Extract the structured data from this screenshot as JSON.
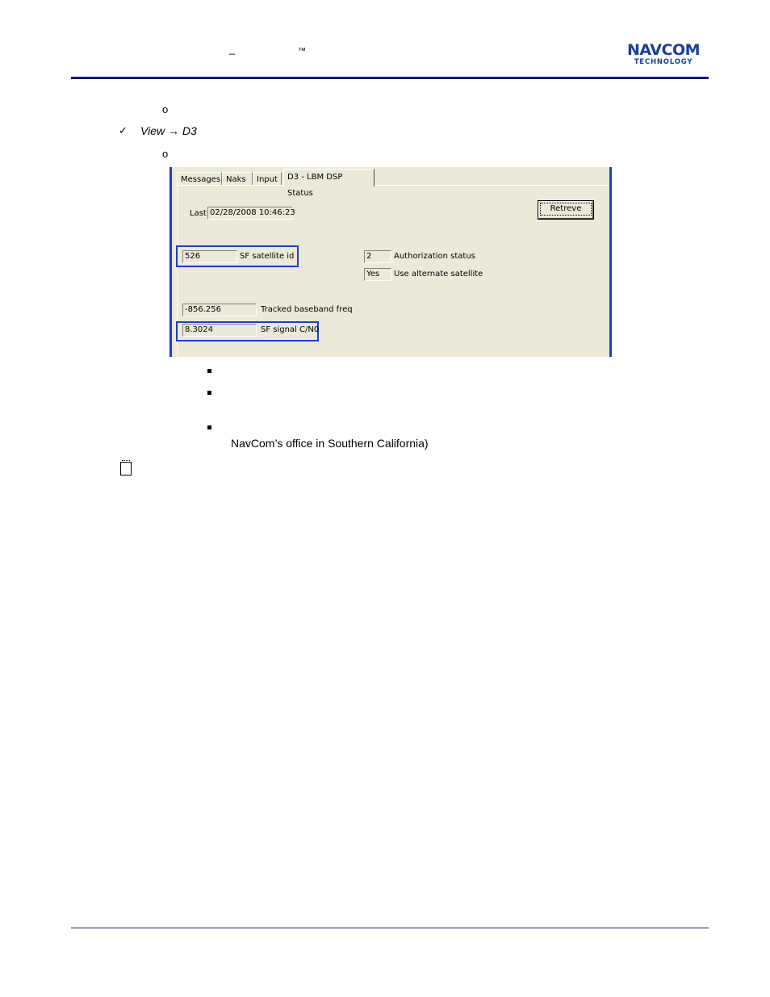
{
  "header": {
    "dash_mark": "_",
    "tm_mark": "™",
    "logo": {
      "line1": "NAVCOM",
      "line2": "TECHNOLOGY"
    }
  },
  "content": {
    "bullet_open_1": "o",
    "check_mark": "✓",
    "view_path": "View → D3",
    "bullet_open_2": "o",
    "closing_text": "NavCom’s office in Southern California)"
  },
  "dialog": {
    "tabs": [
      "Messages",
      "Naks",
      "Input",
      "D3 - LBM DSP Status"
    ],
    "last_label": "Last",
    "last_value": "02/28/2008 10:46:23",
    "retrieve_label": "Retreve",
    "sf_satellite_id": {
      "value": "526",
      "label": "SF satellite id"
    },
    "authorization_status": {
      "value": "2",
      "label": "Authorization status"
    },
    "use_alternate_satellite": {
      "value": "Yes",
      "label": "Use alternate satellite"
    },
    "tracked_baseband_freq": {
      "value": "-856.256",
      "label": "Tracked baseband freq"
    },
    "sf_signal_cn0": {
      "value": "8.3024",
      "label": "SF signal C/N0"
    }
  },
  "colors": {
    "rule": "#0b1b7a",
    "logo": "#1c3f94",
    "highlight": "#1a3fc8",
    "dialog_bg": "#ece9d8"
  }
}
